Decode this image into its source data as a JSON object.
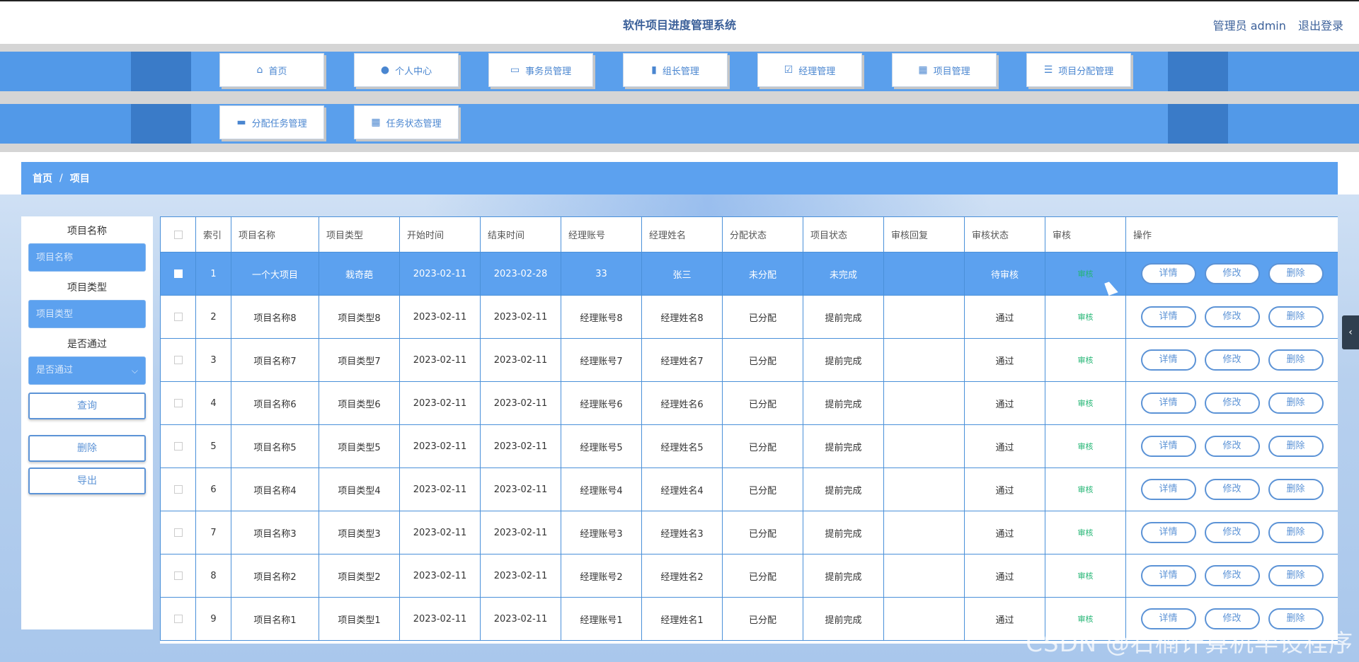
{
  "header": {
    "title": "软件项目进度管理系统",
    "user_label": "管理员 admin",
    "logout": "退出登录"
  },
  "nav": {
    "row1": [
      {
        "label": "首页",
        "icon": "home-icon",
        "glyph": "⌂"
      },
      {
        "label": "个人中心",
        "icon": "user-icon",
        "glyph": "●"
      },
      {
        "label": "事务员管理",
        "icon": "monitor-icon",
        "glyph": "▭"
      },
      {
        "label": "组长管理",
        "icon": "bar-chart-icon",
        "glyph": "▮"
      },
      {
        "label": "经理管理",
        "icon": "clipboard-check-icon",
        "glyph": "☑"
      },
      {
        "label": "项目管理",
        "icon": "grid-icon",
        "glyph": "▦"
      },
      {
        "label": "项目分配管理",
        "icon": "sliders-icon",
        "glyph": "☰"
      }
    ],
    "row2": [
      {
        "label": "分配任务管理",
        "icon": "comment-icon",
        "glyph": "▬"
      },
      {
        "label": "任务状态管理",
        "icon": "grid-icon",
        "glyph": "▦"
      }
    ]
  },
  "breadcrumb": {
    "home": "首页",
    "sep": "/",
    "current": "项目"
  },
  "search": {
    "name_label": "项目名称",
    "name_placeholder": "项目名称",
    "type_label": "项目类型",
    "type_placeholder": "项目类型",
    "pass_label": "是否通过",
    "pass_placeholder": "是否通过",
    "query": "查询",
    "delete": "删除",
    "export": "导出"
  },
  "table": {
    "columns": [
      "索引",
      "项目名称",
      "项目类型",
      "开始时间",
      "结束时间",
      "经理账号",
      "经理姓名",
      "分配状态",
      "项目状态",
      "审核回复",
      "审核状态",
      "审核",
      "操作"
    ],
    "rows": [
      {
        "index": "1",
        "name": "一个大项目",
        "type": "栽奇葩",
        "start": "2023-02-11",
        "end": "2023-02-28",
        "account": "33",
        "manager": "张三",
        "assign": "未分配",
        "status": "未完成",
        "reply": "",
        "audit_status": "待审核",
        "audit": "审核"
      },
      {
        "index": "2",
        "name": "项目名称8",
        "type": "项目类型8",
        "start": "2023-02-11",
        "end": "2023-02-11",
        "account": "经理账号8",
        "manager": "经理姓名8",
        "assign": "已分配",
        "status": "提前完成",
        "reply": "",
        "audit_status": "通过",
        "audit": "审核"
      },
      {
        "index": "3",
        "name": "项目名称7",
        "type": "项目类型7",
        "start": "2023-02-11",
        "end": "2023-02-11",
        "account": "经理账号7",
        "manager": "经理姓名7",
        "assign": "已分配",
        "status": "提前完成",
        "reply": "",
        "audit_status": "通过",
        "audit": "审核"
      },
      {
        "index": "4",
        "name": "项目名称6",
        "type": "项目类型6",
        "start": "2023-02-11",
        "end": "2023-02-11",
        "account": "经理账号6",
        "manager": "经理姓名6",
        "assign": "已分配",
        "status": "提前完成",
        "reply": "",
        "audit_status": "通过",
        "audit": "审核"
      },
      {
        "index": "5",
        "name": "项目名称5",
        "type": "项目类型5",
        "start": "2023-02-11",
        "end": "2023-02-11",
        "account": "经理账号5",
        "manager": "经理姓名5",
        "assign": "已分配",
        "status": "提前完成",
        "reply": "",
        "audit_status": "通过",
        "audit": "审核"
      },
      {
        "index": "6",
        "name": "项目名称4",
        "type": "项目类型4",
        "start": "2023-02-11",
        "end": "2023-02-11",
        "account": "经理账号4",
        "manager": "经理姓名4",
        "assign": "已分配",
        "status": "提前完成",
        "reply": "",
        "audit_status": "通过",
        "audit": "审核"
      },
      {
        "index": "7",
        "name": "项目名称3",
        "type": "项目类型3",
        "start": "2023-02-11",
        "end": "2023-02-11",
        "account": "经理账号3",
        "manager": "经理姓名3",
        "assign": "已分配",
        "status": "提前完成",
        "reply": "",
        "audit_status": "通过",
        "audit": "审核"
      },
      {
        "index": "8",
        "name": "项目名称2",
        "type": "项目类型2",
        "start": "2023-02-11",
        "end": "2023-02-11",
        "account": "经理账号2",
        "manager": "经理姓名2",
        "assign": "已分配",
        "status": "提前完成",
        "reply": "",
        "audit_status": "通过",
        "audit": "审核"
      },
      {
        "index": "9",
        "name": "项目名称1",
        "type": "项目类型1",
        "start": "2023-02-11",
        "end": "2023-02-11",
        "account": "经理账号1",
        "manager": "经理姓名1",
        "assign": "已分配",
        "status": "提前完成",
        "reply": "",
        "audit_status": "通过",
        "audit": "审核"
      }
    ],
    "actions": {
      "detail": "详情",
      "edit": "修改",
      "delete": "删除"
    }
  },
  "watermark": "CSDN @石楠计算机毕设程序"
}
